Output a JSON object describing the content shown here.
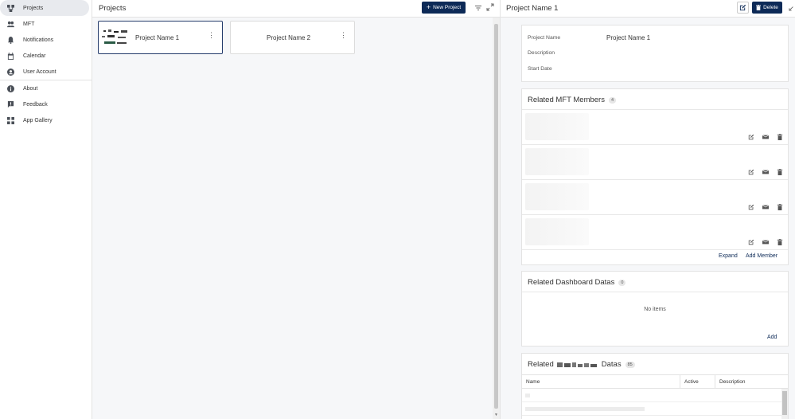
{
  "sidebar": {
    "items": [
      {
        "label": "Projects",
        "icon": "projects-icon",
        "active": true
      },
      {
        "label": "MFT",
        "icon": "group-icon"
      },
      {
        "label": "Notifications",
        "icon": "bell-icon"
      },
      {
        "label": "Calendar",
        "icon": "calendar-icon"
      },
      {
        "label": "User Account",
        "icon": "account-icon"
      }
    ],
    "items2": [
      {
        "label": "About",
        "icon": "info-icon"
      },
      {
        "label": "Feedback",
        "icon": "feedback-icon"
      },
      {
        "label": "App Gallery",
        "icon": "grid-icon"
      }
    ]
  },
  "projects": {
    "title": "Projects",
    "new_button": "New Project",
    "cards": [
      {
        "name": "Project Name 1",
        "selected": true
      },
      {
        "name": "Project Name 2",
        "selected": false
      }
    ]
  },
  "detail": {
    "title": "Project Name 1",
    "delete_button": "Delete",
    "info": {
      "project_name_label": "Project Name",
      "project_name_value": "Project Name 1",
      "description_label": "Description",
      "start_date_label": "Start Date"
    },
    "members": {
      "title": "Related MFT Members",
      "count": "4",
      "expand_link": "Expand",
      "add_link": "Add Member"
    },
    "dashboard": {
      "title": "Related Dashboard Datas",
      "count": "0",
      "empty_text": "No items",
      "add_link": "Add"
    },
    "datas": {
      "title_prefix": "Related",
      "title_suffix": "Datas",
      "count": "85",
      "columns": [
        "Name",
        "Active",
        "Description"
      ]
    }
  },
  "colors": {
    "primary": "#0d2a57",
    "sidebar_active": "#e8eaee",
    "panel_bg": "#f6f7f9"
  }
}
